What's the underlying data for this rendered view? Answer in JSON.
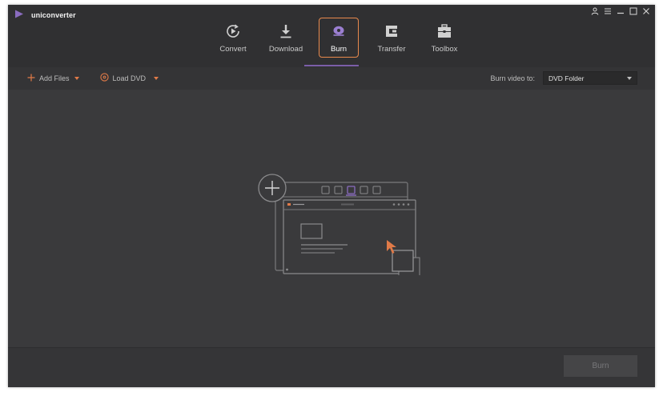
{
  "app": {
    "title": "uniconverter",
    "accent": "#e98a4d",
    "brand_color": "#8a6cc0"
  },
  "window_controls": {
    "icons": [
      "user-icon",
      "menu-icon",
      "minimize-icon",
      "close-icon"
    ]
  },
  "nav": {
    "tabs": [
      {
        "label": "Convert",
        "icon": "convert-icon",
        "active": false
      },
      {
        "label": "Download",
        "icon": "download-icon",
        "active": false
      },
      {
        "label": "Burn",
        "icon": "burn-icon",
        "active": true
      },
      {
        "label": "Transfer",
        "icon": "transfer-icon",
        "active": false
      },
      {
        "label": "Toolbox",
        "icon": "toolbox-icon",
        "active": false
      }
    ]
  },
  "toolbar": {
    "add_files_label": "Add Files",
    "load_dvd_label": "Load DVD",
    "burn_to_label": "Burn video to:",
    "burn_to_value": "DVD Folder"
  },
  "footer": {
    "burn_label": "Burn"
  }
}
